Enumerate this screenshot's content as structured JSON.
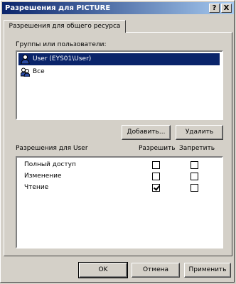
{
  "window": {
    "title": "Разрешения для PICTURE",
    "help_btn": "?",
    "close_btn": "X"
  },
  "tabs": [
    {
      "label": "Разрешения для общего ресурса"
    }
  ],
  "users_section": {
    "label": "Группы или пользователи:",
    "items": [
      {
        "label": "User (EYS01\\User)",
        "selected": true,
        "icon": "user-icon"
      },
      {
        "label": "Все",
        "selected": false,
        "icon": "group-icon"
      }
    ],
    "add_button": "Добавить...",
    "remove_button": "Удалить"
  },
  "permissions_section": {
    "label": "Разрешения для User",
    "col_allow": "Разрешить",
    "col_deny": "Запретить",
    "rows": [
      {
        "name": "Полный доступ",
        "allow": false,
        "deny": false
      },
      {
        "name": "Изменение",
        "allow": false,
        "deny": false
      },
      {
        "name": "Чтение",
        "allow": true,
        "deny": false
      }
    ]
  },
  "footer": {
    "ok": "OK",
    "cancel": "Отмена",
    "apply": "Применить"
  }
}
